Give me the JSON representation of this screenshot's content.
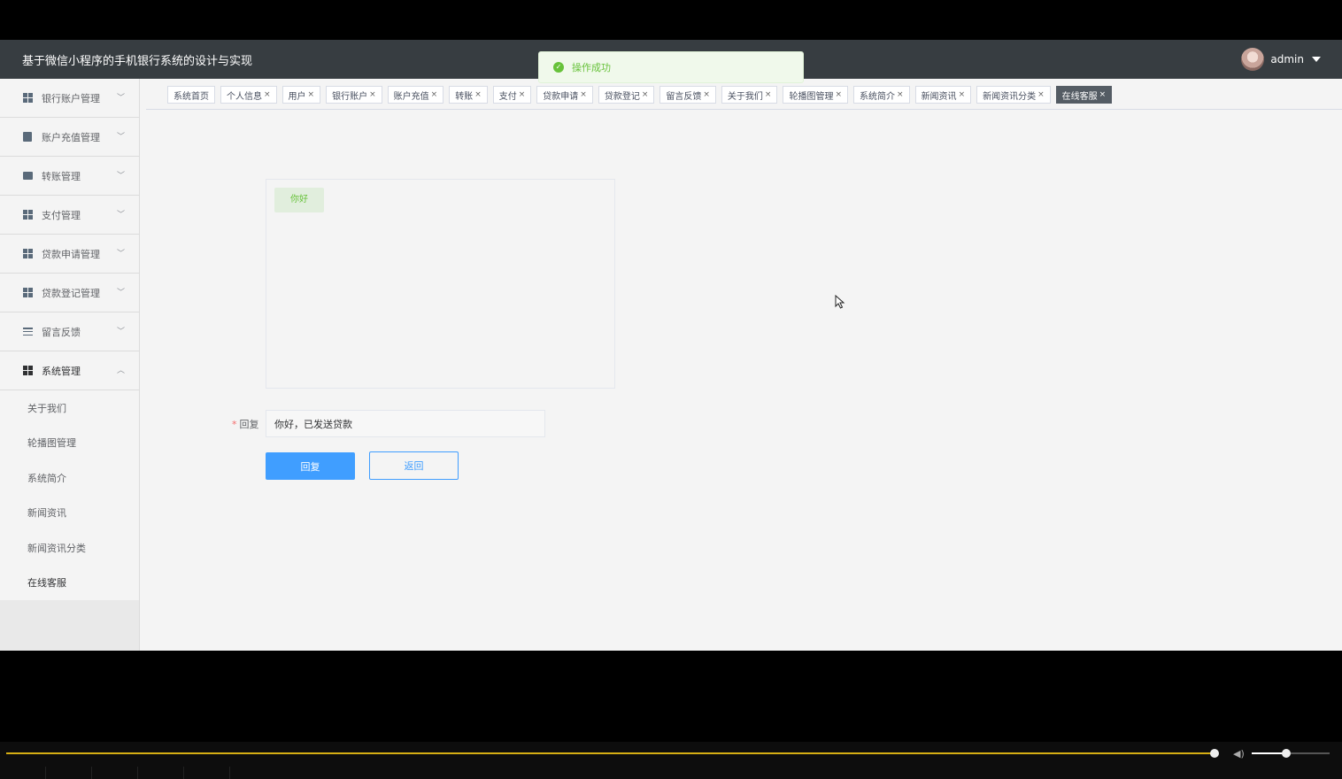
{
  "header": {
    "title": "基于微信小程序的手机银行系统的设计与实现",
    "user_name": "admin"
  },
  "toast": {
    "message": "操作成功"
  },
  "sidebar": {
    "menus": [
      {
        "label": "银行账户管理"
      },
      {
        "label": "账户充值管理"
      },
      {
        "label": "转账管理"
      },
      {
        "label": "支付管理"
      },
      {
        "label": "贷款申请管理"
      },
      {
        "label": "贷款登记管理"
      },
      {
        "label": "留言反馈"
      },
      {
        "label": "系统管理"
      }
    ],
    "sub_items": [
      {
        "label": "关于我们"
      },
      {
        "label": "轮播图管理"
      },
      {
        "label": "系统简介"
      },
      {
        "label": "新闻资讯"
      },
      {
        "label": "新闻资讯分类"
      },
      {
        "label": "在线客服"
      }
    ]
  },
  "tags": [
    {
      "label": "系统首页",
      "closable": false
    },
    {
      "label": "个人信息",
      "closable": true
    },
    {
      "label": "用户",
      "closable": true
    },
    {
      "label": "银行账户",
      "closable": true
    },
    {
      "label": "账户充值",
      "closable": true
    },
    {
      "label": "转账",
      "closable": true
    },
    {
      "label": "支付",
      "closable": true
    },
    {
      "label": "贷款申请",
      "closable": true
    },
    {
      "label": "贷款登记",
      "closable": true
    },
    {
      "label": "留言反馈",
      "closable": true
    },
    {
      "label": "关于我们",
      "closable": true
    },
    {
      "label": "轮播图管理",
      "closable": true
    },
    {
      "label": "系统简介",
      "closable": true
    },
    {
      "label": "新闻资讯",
      "closable": true
    },
    {
      "label": "新闻资讯分类",
      "closable": true
    },
    {
      "label": "在线客服",
      "closable": true,
      "active": true
    }
  ],
  "tag_close_symbol": "×",
  "chat": {
    "messages": [
      {
        "text": "你好"
      }
    ]
  },
  "form": {
    "reply_label": "回复",
    "required_mark": "*",
    "reply_value": "你好，已发送贷款",
    "submit_label": "回复",
    "back_label": "返回"
  },
  "player": {
    "progress": 0.9,
    "volume": 0.4
  },
  "colors": {
    "header_bg": "#373d41",
    "primary": "#409eff",
    "success": "#67c23a",
    "progress_bar": "#d6ae14"
  }
}
